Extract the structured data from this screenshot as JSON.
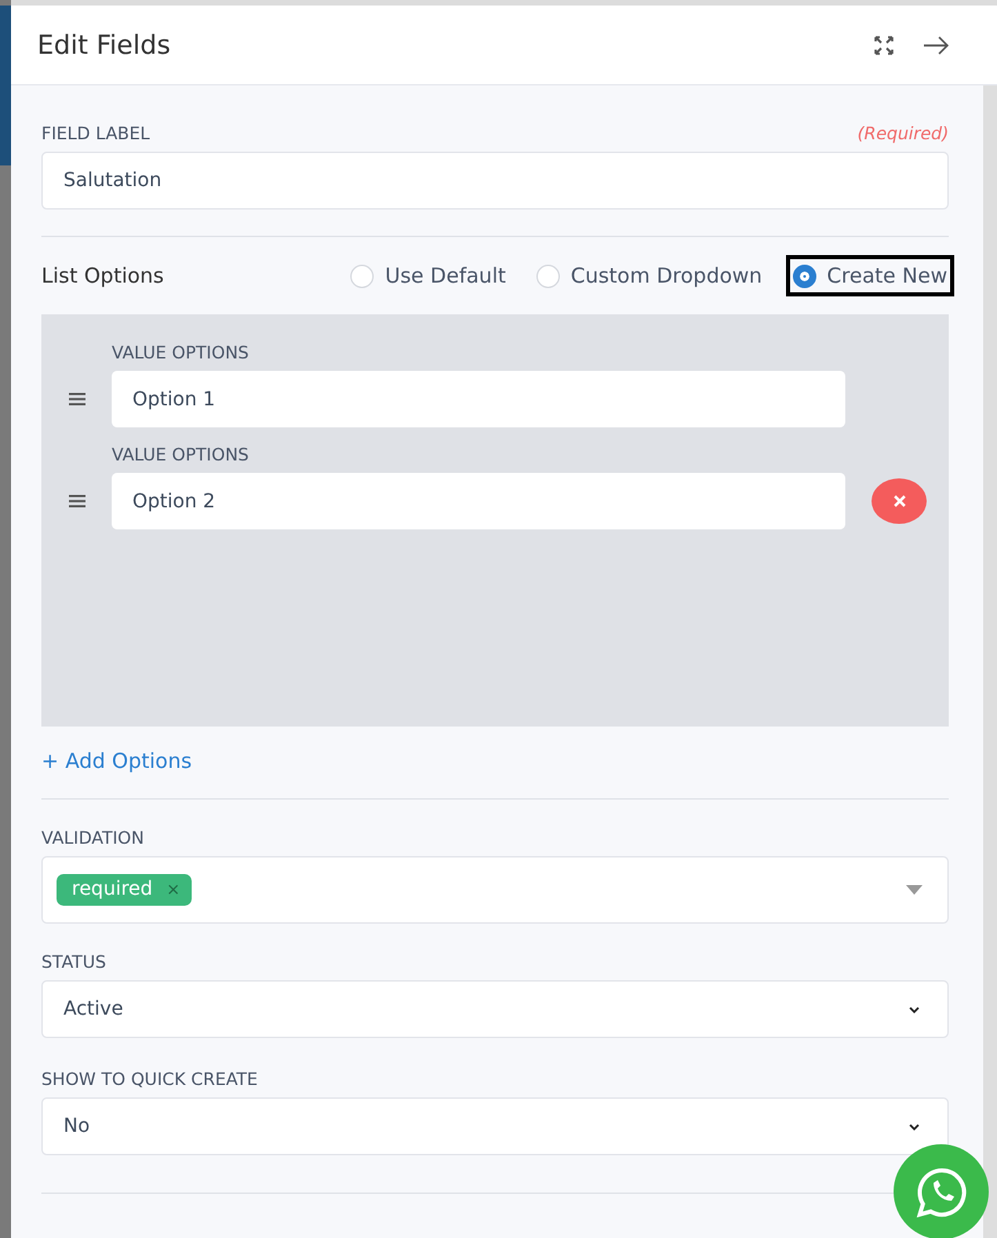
{
  "panel": {
    "title": "Edit Fields"
  },
  "field_label": {
    "label": "FIELD LABEL",
    "required_note": "(Required)",
    "value": "Salutation"
  },
  "list_options": {
    "label": "List Options",
    "choices": [
      {
        "label": "Use Default",
        "selected": false
      },
      {
        "label": "Custom Dropdown",
        "selected": false
      },
      {
        "label": "Create New",
        "selected": true
      }
    ],
    "values": [
      {
        "label": "VALUE OPTIONS",
        "value": "Option 1",
        "removable": false
      },
      {
        "label": "VALUE OPTIONS",
        "value": "Option 2",
        "removable": true
      }
    ],
    "add_link": "+ Add Options"
  },
  "validation": {
    "label": "VALIDATION",
    "tags": [
      "required"
    ],
    "tag_remove": "×"
  },
  "status": {
    "label": "STATUS",
    "value": "Active"
  },
  "quick_create": {
    "label": "SHOW TO QUICK CREATE",
    "value": "No"
  }
}
